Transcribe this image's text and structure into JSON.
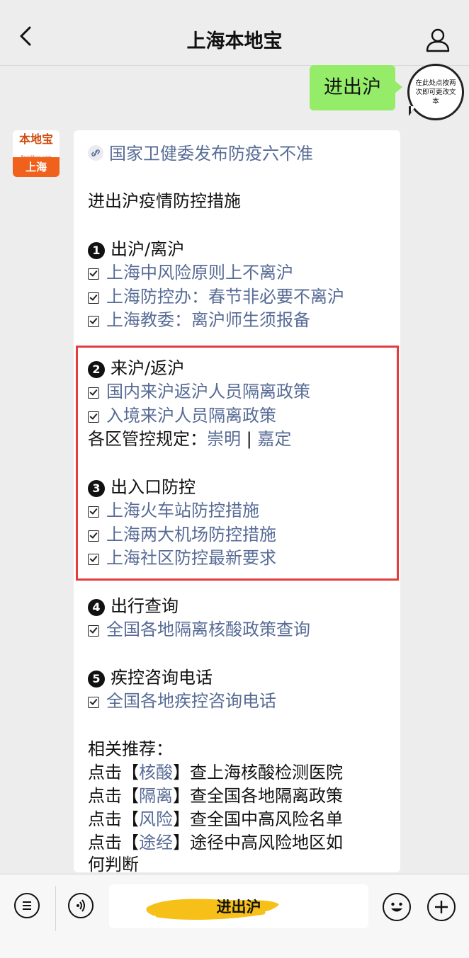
{
  "header": {
    "title": "上海本地宝"
  },
  "chat": {
    "sent_message": "进出沪",
    "my_avatar_text": "在此处点按两次即可更改文本",
    "bot_avatar": {
      "top": "本地宝",
      "sub": "Bendibao.com",
      "bottom": "上海"
    }
  },
  "card": {
    "top_link": "国家卫健委发布防疫六不准",
    "intro": "进出沪疫情防控措施",
    "sections": [
      {
        "num": "1",
        "title": "出沪/离沪",
        "links": [
          "上海中风险原则上不离沪",
          "上海防控办：春节非必要不离沪",
          "上海教委：离沪师生须报备"
        ]
      },
      {
        "num": "2",
        "title": "来沪/返沪",
        "links": [
          "国内来沪返沪人员隔离政策",
          "入境来沪人员隔离政策"
        ],
        "district_label": "各区管控规定：",
        "district_links": [
          "崇明",
          "嘉定"
        ],
        "district_sep": "|"
      },
      {
        "num": "3",
        "title": "出入口防控",
        "links": [
          "上海火车站防控措施",
          "上海两大机场防控措施",
          "上海社区防控最新要求"
        ]
      },
      {
        "num": "4",
        "title": "出行查询",
        "links": [
          "全国各地隔离核酸政策查询"
        ]
      },
      {
        "num": "5",
        "title": "疾控咨询电话",
        "links": [
          "全国各地疾控咨询电话"
        ]
      }
    ],
    "related": {
      "label": "相关推荐：",
      "items": [
        {
          "prefix": "点击【",
          "keyword": "核酸",
          "suffix": "】查上海核酸检测医院"
        },
        {
          "prefix": "点击【",
          "keyword": "隔离",
          "suffix": "】查全国各地隔离政策"
        },
        {
          "prefix": "点击【",
          "keyword": "风险",
          "suffix": "】查全国中高风险名单"
        },
        {
          "prefix": "点击【",
          "keyword": "途经",
          "suffix": "】途径中高风险地区如"
        }
      ],
      "wrap": "何判断"
    }
  },
  "bottom": {
    "input_text": "进出沪"
  },
  "colors": {
    "link": "#576b95",
    "bubble": "#95ec69",
    "highlight": "#e43d3d",
    "brush": "#f6c018"
  }
}
